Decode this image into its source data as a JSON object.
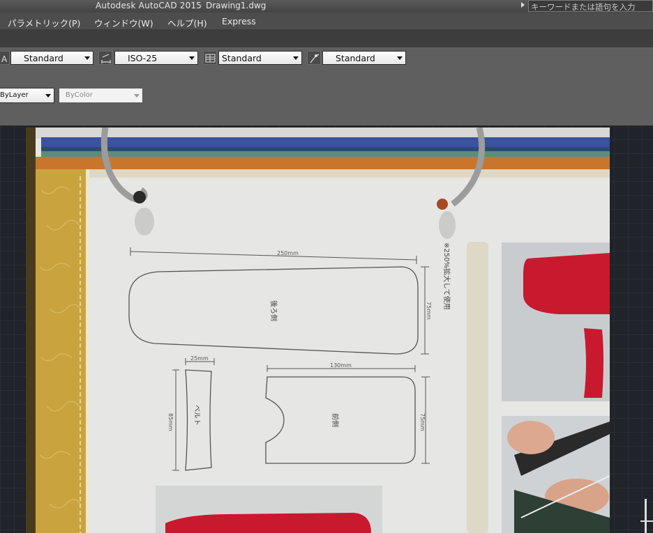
{
  "window": {
    "app_title": "Autodesk AutoCAD 2015",
    "file_name": "Drawing1.dwg"
  },
  "search": {
    "placeholder": "キーワードまたは語句を入力"
  },
  "menu": {
    "items": [
      "パラメトリック(P)",
      "ウィンドウ(W)",
      "ヘルプ(H)",
      "Express"
    ]
  },
  "styles_toolbar": {
    "text_style": "Standard",
    "dim_style": "ISO-25",
    "table_style": "Standard",
    "multileader_style": "Standard"
  },
  "properties_toolbar": {
    "linetype": "ByLayer",
    "color": "ByColor"
  },
  "drawing_photo": {
    "dim_back_width": "250mm",
    "dim_back_height": "75mm",
    "label_back": "後ろ側",
    "dim_belt_width": "25mm",
    "dim_belt_height": "85mm",
    "label_belt": "ベルト",
    "dim_front_width": "130mm",
    "dim_front_height": "75mm",
    "label_front": "前側",
    "side_note": "※250%拡大して使用",
    "colors": {
      "paper": "#e6e7e4",
      "leather_red": "#c8192e",
      "binder_blue": "#3a52a0",
      "binder_orange": "#c9762c",
      "strip_yellow": "#c9a43e"
    }
  }
}
